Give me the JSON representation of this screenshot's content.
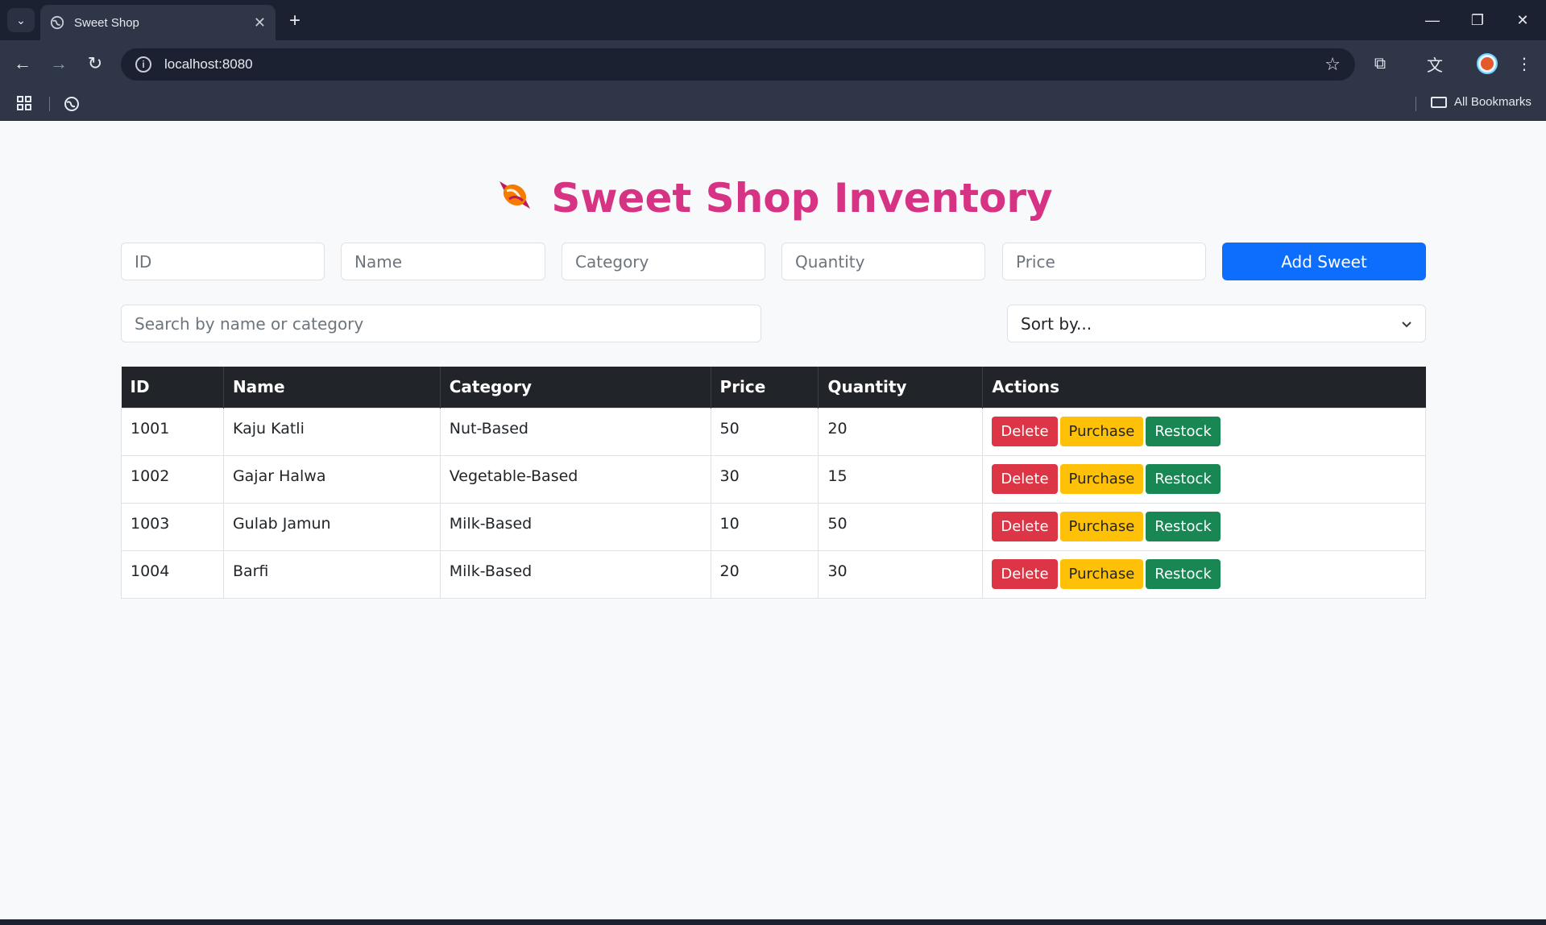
{
  "browser": {
    "tab_title": "Sweet Shop",
    "url": "localhost:8080",
    "bookmarks_label": "All Bookmarks"
  },
  "page": {
    "title": "Sweet Shop Inventory",
    "title_color": "#d63384"
  },
  "form": {
    "id_placeholder": "ID",
    "name_placeholder": "Name",
    "category_placeholder": "Category",
    "quantity_placeholder": "Quantity",
    "price_placeholder": "Price",
    "submit_label": "Add Sweet"
  },
  "filters": {
    "search_placeholder": "Search by name or category",
    "sort_value": "Sort by..."
  },
  "table": {
    "headers": [
      "ID",
      "Name",
      "Category",
      "Price",
      "Quantity",
      "Actions"
    ],
    "rows": [
      {
        "id": "1001",
        "name": "Kaju Katli",
        "category": "Nut-Based",
        "price": "50",
        "quantity": "20"
      },
      {
        "id": "1002",
        "name": "Gajar Halwa",
        "category": "Vegetable-Based",
        "price": "30",
        "quantity": "15"
      },
      {
        "id": "1003",
        "name": "Gulab Jamun",
        "category": "Milk-Based",
        "price": "10",
        "quantity": "50"
      },
      {
        "id": "1004",
        "name": "Barfi",
        "category": "Milk-Based",
        "price": "20",
        "quantity": "30"
      }
    ],
    "actions": {
      "delete": "Delete",
      "purchase": "Purchase",
      "restock": "Restock"
    }
  },
  "colors": {
    "primary": "#0d6efd",
    "danger": "#dc3545",
    "warning": "#ffc107",
    "success": "#198754",
    "table_header": "#212529"
  }
}
